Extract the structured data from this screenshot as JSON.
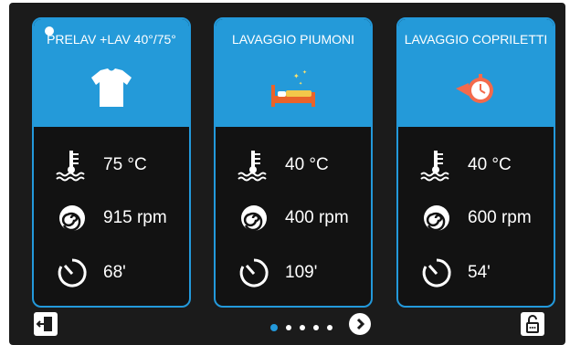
{
  "cards": [
    {
      "title": "PRELAV +LAV 40°/75°",
      "icon": "tshirt-icon",
      "temperature": "75 °C",
      "spin": "915 rpm",
      "time": "68'"
    },
    {
      "title": "LAVAGGIO PIUMONI",
      "icon": "bed-icon",
      "temperature": "40 °C",
      "spin": "400 rpm",
      "time": "109'"
    },
    {
      "title": "LAVAGGIO COPRILETTI",
      "icon": "fast-timer-icon",
      "temperature": "40 °C",
      "spin": "600 rpm",
      "time": "54'"
    }
  ],
  "pagination": {
    "pages": 5,
    "active_index": 0
  },
  "colors": {
    "accent": "#2399db",
    "background": "#1b1b1b",
    "card_background": "#121212",
    "text": "#ffffff"
  }
}
